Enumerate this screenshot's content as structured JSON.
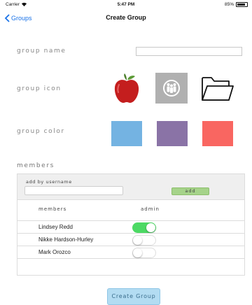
{
  "status_bar": {
    "carrier": "Carrier",
    "time": "5:47 PM",
    "battery_text": "85%",
    "battery_level": 0.85
  },
  "nav": {
    "back_label": "Groups",
    "title": "Create Group"
  },
  "form": {
    "group_name_label": "group name",
    "group_name_value": "",
    "group_icon_label": "group icon",
    "icons": [
      "apple-icon",
      "people-icon",
      "folder-icon"
    ],
    "group_color_label": "group color",
    "colors": [
      "#74b3e2",
      "#8a73a6",
      "#f96661"
    ]
  },
  "members_section": {
    "heading": "members",
    "add_label": "add by username",
    "add_input_value": "",
    "add_button": "add",
    "col_members": "members",
    "col_admin": "admin",
    "rows": [
      {
        "name": "Lindsey Redd",
        "admin": true
      },
      {
        "name": "Nikke Hardson-Hurley",
        "admin": false
      },
      {
        "name": "Mark Orozco",
        "admin": false
      }
    ]
  },
  "create_button": "Create Group",
  "accent": "#1a73e8",
  "toggle_on_color": "#4cd964"
}
